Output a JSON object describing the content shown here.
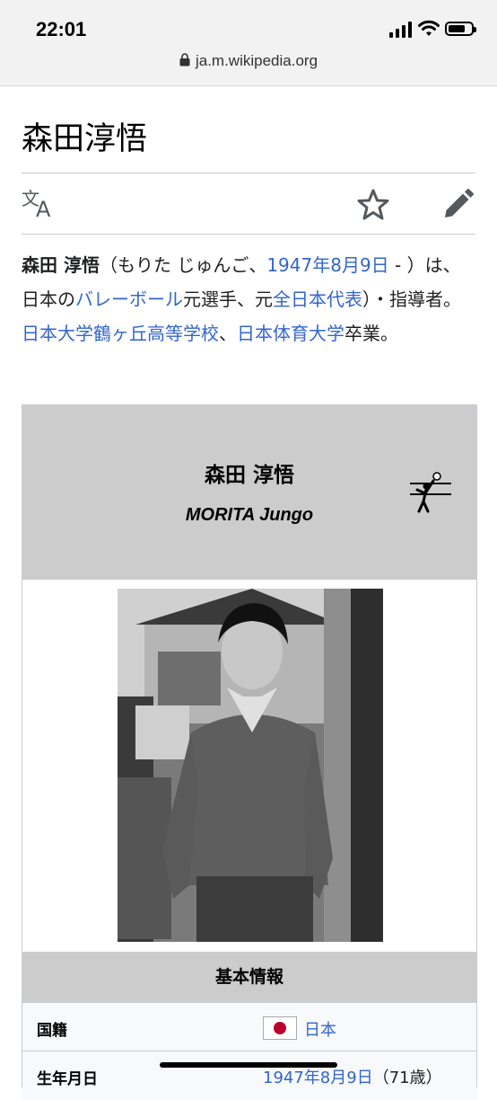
{
  "status": {
    "time": "22:01",
    "battery_level": 0.75,
    "url": "ja.m.wikipedia.org"
  },
  "article": {
    "title": "森田淳悟",
    "intro": {
      "name_bold": "森田 淳悟",
      "reading": "（もりた じゅんご、",
      "birth_link": "1947年8月9日",
      "dash": " - ）",
      "p2": "は、日本の",
      "volleyball_link": "バレーボール",
      "p3": "元選手、元",
      "national_team_link": "全日本代表",
      "p4": "）・指導者。",
      "school_link": "日本大学鶴ヶ丘高等学校",
      "p5": "、",
      "univ_link": "日本体育大学",
      "p6": "卒業。"
    }
  },
  "infobox": {
    "name": "森田 淳悟",
    "latin_name": "MORITA Jungo",
    "section_title": "基本情報",
    "rows": [
      {
        "label": "国籍",
        "value": "日本",
        "flag_color": "#bc002d"
      },
      {
        "label": "生年月日",
        "value_link": "1947年8月9日",
        "value_suffix": "（71歳）"
      }
    ]
  },
  "colors": {
    "link": "#3366cc",
    "header_bg": "#cccccc",
    "statusbar_bg": "#f2f2f2"
  }
}
